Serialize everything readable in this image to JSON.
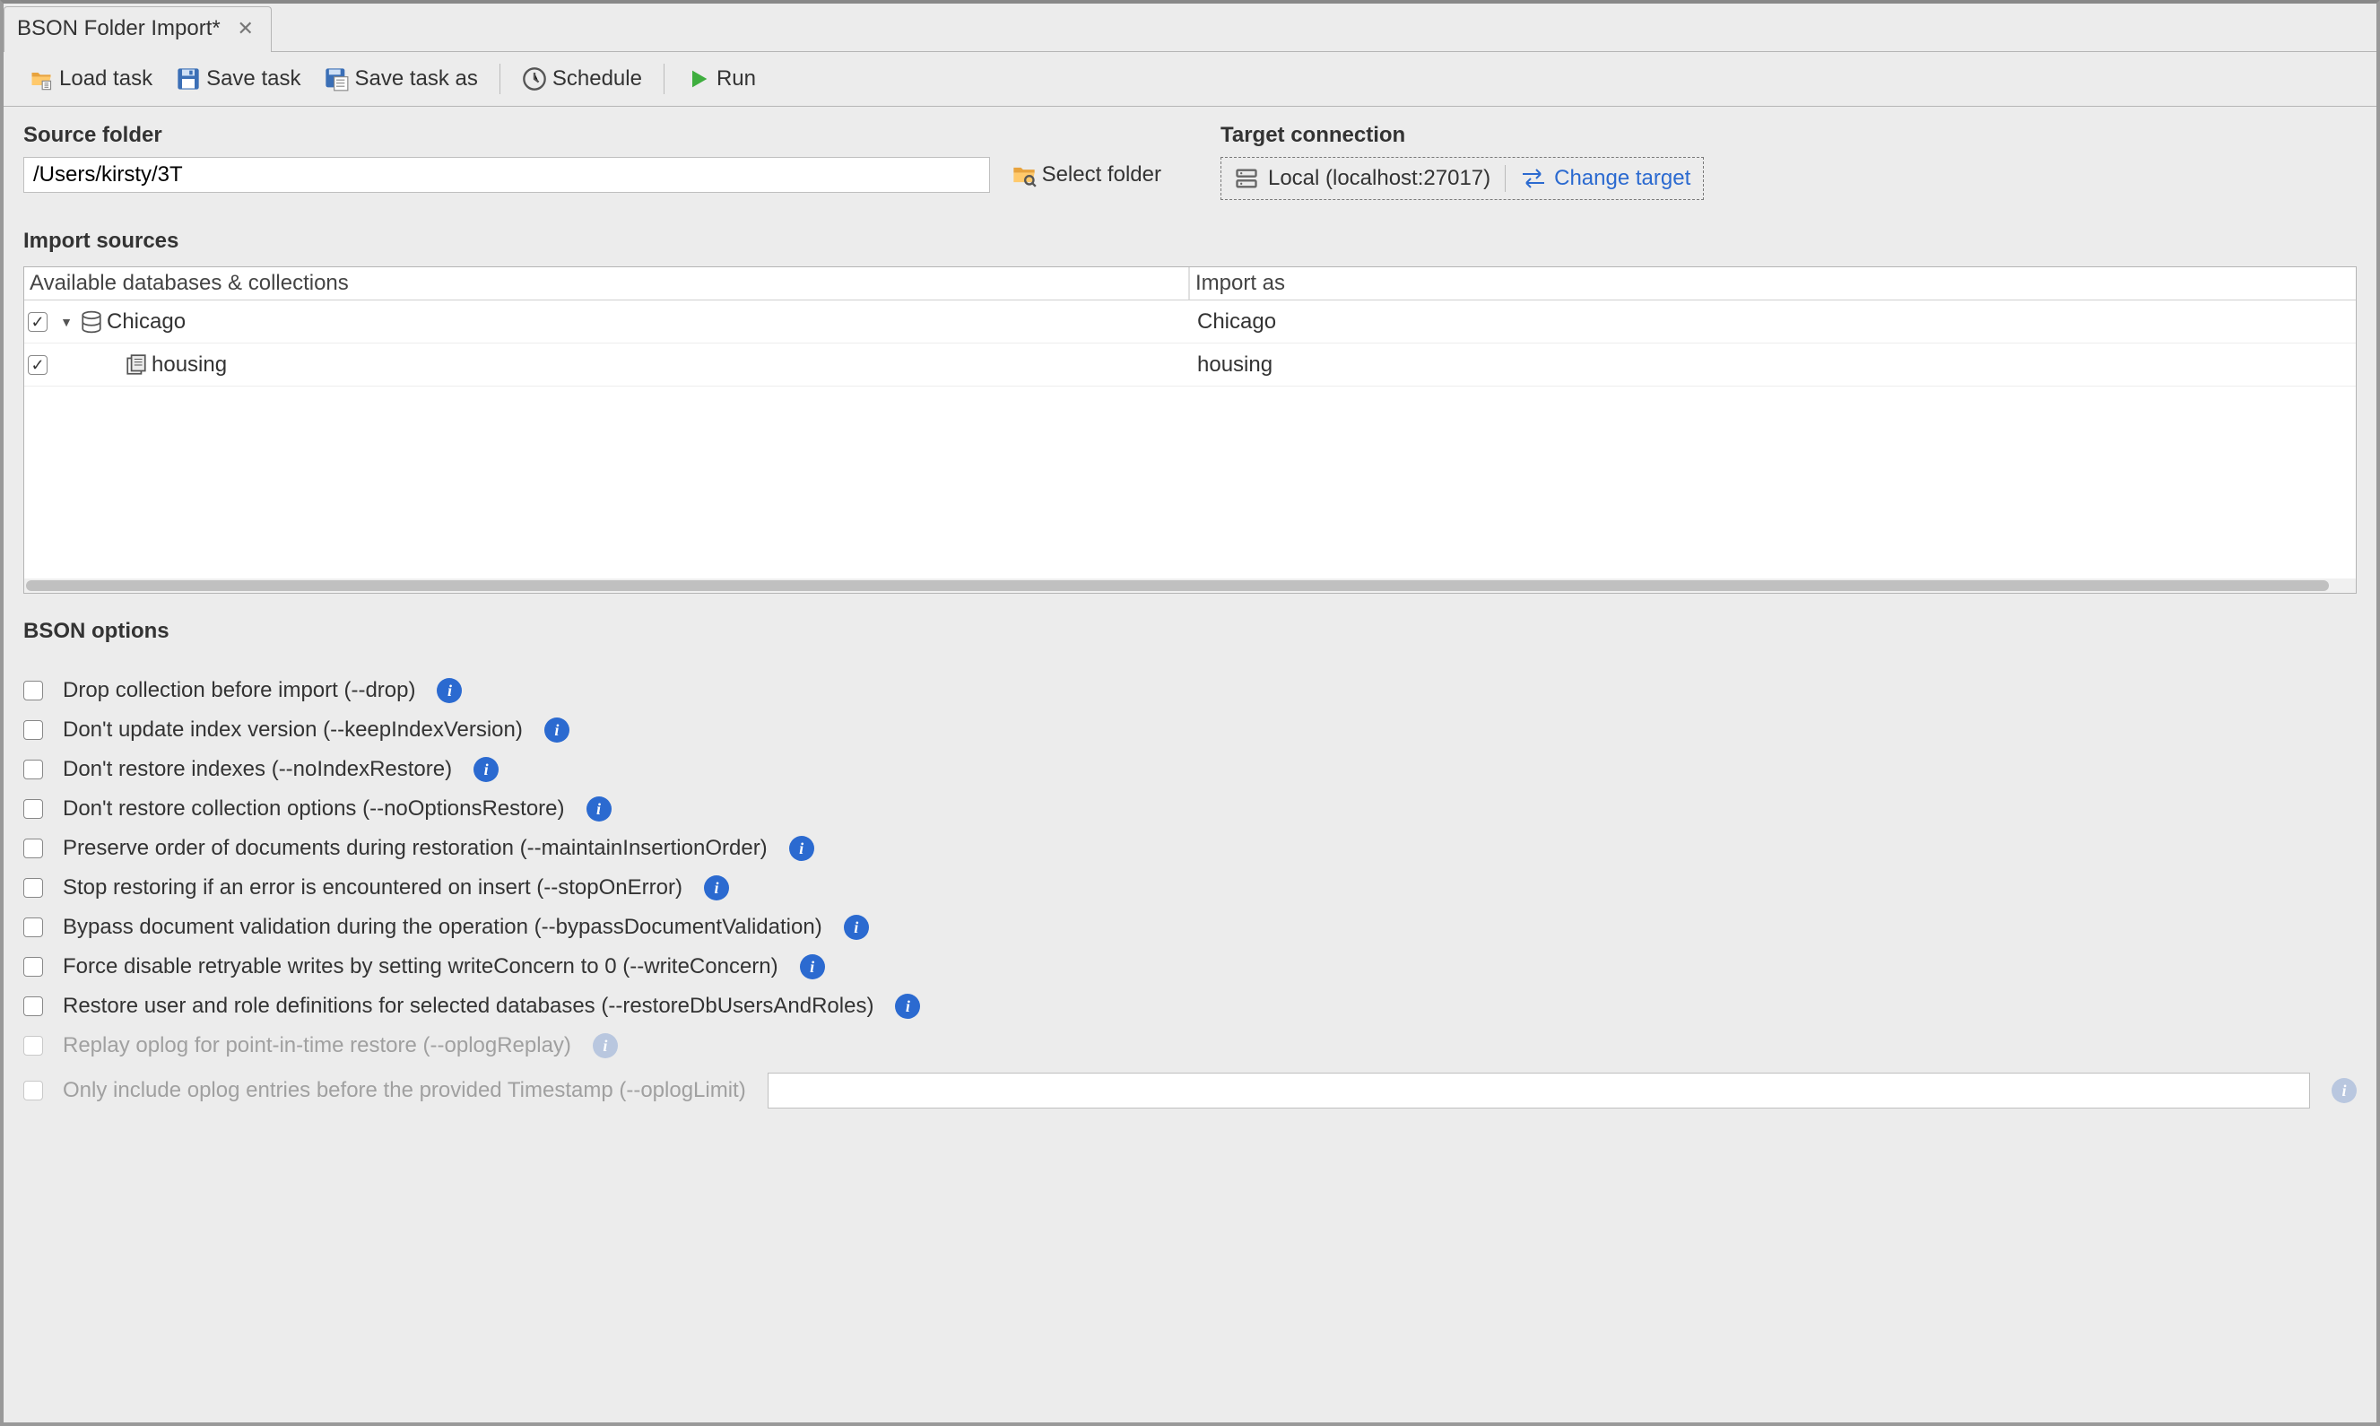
{
  "tab": {
    "title": "BSON Folder Import*"
  },
  "toolbar": {
    "load_task": "Load task",
    "save_task": "Save task",
    "save_task_as": "Save task as",
    "schedule": "Schedule",
    "run": "Run"
  },
  "source": {
    "label": "Source folder",
    "path": "/Users/kirsty/3T",
    "select_btn": "Select folder"
  },
  "target": {
    "label": "Target connection",
    "name": "Local (localhost:27017)",
    "change": "Change target"
  },
  "import_sources": {
    "label": "Import sources",
    "col_left": "Available databases & collections",
    "col_right": "Import as",
    "rows": [
      {
        "name": "Chicago",
        "import_as": "Chicago",
        "type": "db",
        "checked": true,
        "expanded": true
      },
      {
        "name": "housing",
        "import_as": "housing",
        "type": "collection",
        "checked": true
      }
    ]
  },
  "options": {
    "label": "BSON options",
    "items": [
      {
        "label": "Drop collection before import (--drop)",
        "disabled": false
      },
      {
        "label": "Don't update index version (--keepIndexVersion)",
        "disabled": false
      },
      {
        "label": "Don't restore indexes (--noIndexRestore)",
        "disabled": false
      },
      {
        "label": "Don't restore collection options (--noOptionsRestore)",
        "disabled": false
      },
      {
        "label": "Preserve order of documents during restoration (--maintainInsertionOrder)",
        "disabled": false
      },
      {
        "label": "Stop restoring if an error is encountered on insert (--stopOnError)",
        "disabled": false
      },
      {
        "label": "Bypass document validation during the operation (--bypassDocumentValidation)",
        "disabled": false
      },
      {
        "label": "Force disable retryable writes by setting writeConcern to 0 (--writeConcern)",
        "disabled": false
      },
      {
        "label": "Restore user and role definitions for selected databases (--restoreDbUsersAndRoles)",
        "disabled": false
      },
      {
        "label": "Replay oplog for point-in-time restore (--oplogReplay)",
        "disabled": true
      },
      {
        "label": "Only include oplog entries before the provided Timestamp (--oplogLimit)",
        "disabled": true,
        "has_input": true
      }
    ]
  }
}
